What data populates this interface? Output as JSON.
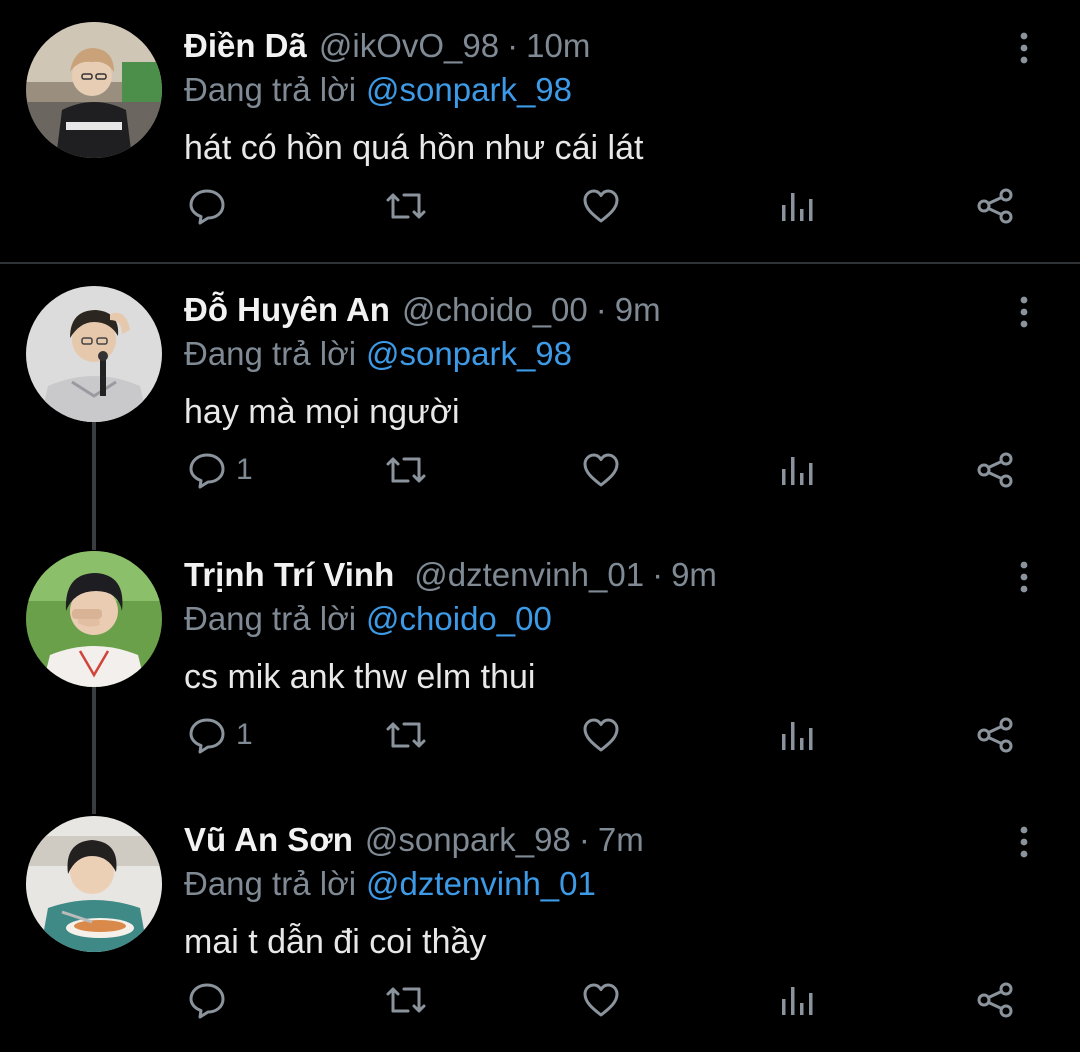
{
  "reply_prefix": "Đang trả lời",
  "separator": "·",
  "colors": {
    "background": "#000000",
    "name": "#f2f2f2",
    "muted": "#7f8a94",
    "link": "#3d9ae6",
    "divider": "#2f3336"
  },
  "icons": {
    "reply": "reply-icon",
    "retweet": "retweet-icon",
    "like": "like-icon",
    "analytics": "analytics-icon",
    "share": "share-icon",
    "more": "more-vertical-icon"
  },
  "tweets": [
    {
      "name": "Điền Dã",
      "handle": "@ikOvO_98",
      "time": "10m",
      "reply_to": "@sonpark_98",
      "text": "hát có hồn quá hồn như cái lát",
      "reply_count": ""
    },
    {
      "name": "Đỗ Huyên An",
      "handle": "@choido_00",
      "time": "9m",
      "reply_to": "@sonpark_98",
      "text": "hay mà mọi người",
      "reply_count": "1"
    },
    {
      "name": "Trịnh Trí Vinh",
      "handle": "@dztenvinh_01",
      "time": "9m",
      "reply_to": "@choido_00",
      "text": "cs mik ank thw elm thui",
      "reply_count": "1"
    },
    {
      "name": "Vũ An Sơn",
      "handle": "@sonpark_98",
      "time": "7m",
      "reply_to": "@dztenvinh_01",
      "text": "mai t dẫn đi coi thầy",
      "reply_count": ""
    }
  ]
}
